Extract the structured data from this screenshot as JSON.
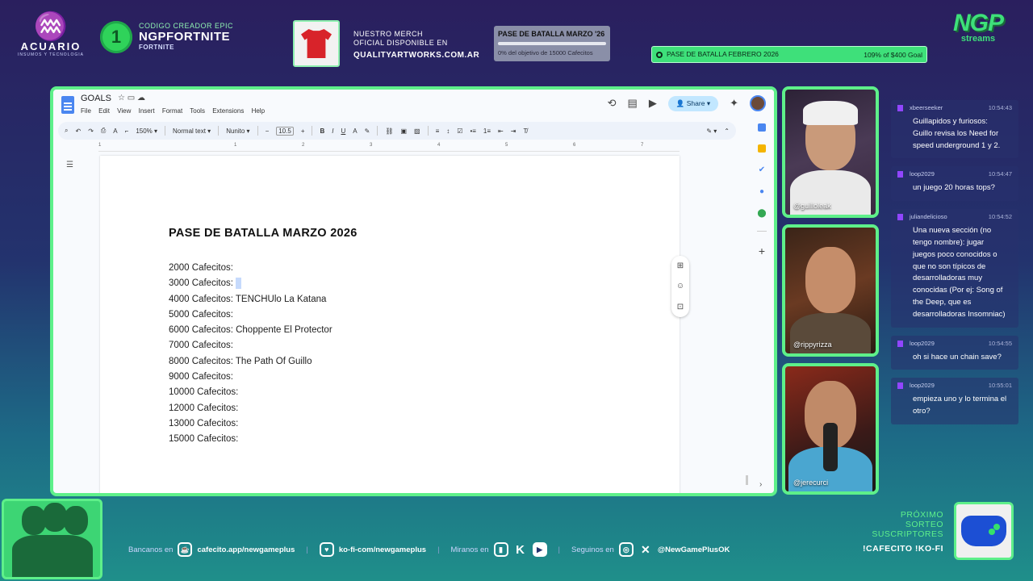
{
  "overlay": {
    "acuario": {
      "name": "ACUARIO",
      "sub": "INSUMOS Y TECNOLOGIA"
    },
    "creator_code": {
      "line1": "CODIGO CREADOR EPIC",
      "line2": "NGPFORTNITE",
      "line3": "FORTNITE",
      "badge": "1"
    },
    "merch": {
      "line1": "NUESTRO MERCH",
      "line2": "OFICIAL DISPONIBLE EN",
      "url": "QUALITYARTWORKS.COM.AR"
    },
    "goal_march": {
      "title": "PASE DE BATALLA MARZO '26",
      "progress": 0,
      "subtitle": "0% del objetivo de 15000 Cafecitos"
    },
    "goal_feb": {
      "title": "PASE DE BATALLA FEBRERO 2026",
      "value": "109% of $400 Goal"
    },
    "brand": {
      "big": "NGP",
      "small": "streams"
    }
  },
  "docs": {
    "title": "GOALS",
    "menu": [
      "File",
      "Edit",
      "View",
      "Insert",
      "Format",
      "Tools",
      "Extensions",
      "Help"
    ],
    "share_label": "Share",
    "toolbar": {
      "zoom": "150%",
      "style": "Normal text",
      "font": "Nunito",
      "font_size": "10.5"
    },
    "ruler": [
      "1",
      "1",
      "2",
      "3",
      "4",
      "5",
      "6",
      "7"
    ],
    "heading": "PASE DE BATALLA MARZO 2026",
    "lines": [
      "2000 Cafecitos:",
      "3000 Cafecitos:",
      "4000 Cafecitos: TENCHUlo La Katana",
      "5000 Cafecitos:",
      "6000 Cafecitos: Choppente El Protector",
      "7000 Cafecitos:",
      "8000 Cafecitos: The Path Of Guillo",
      "9000 Cafecitos:",
      "10000 Cafecitos:",
      "12000 Cafecitos:",
      "13000 Cafecitos:",
      "15000 Cafecitos:"
    ]
  },
  "cams": [
    {
      "handle": "@guilloleak"
    },
    {
      "handle": "@rippyrizza"
    },
    {
      "handle": "@jerecurci"
    }
  ],
  "chat": [
    {
      "user": "xbeerseeker",
      "time": "10:54:43",
      "text": "Guillapidos y furiosos: Guillo revisa los Need for speed underground 1 y 2."
    },
    {
      "user": "loop2029",
      "time": "10:54:47",
      "text": "un juego 20 horas tops?"
    },
    {
      "user": "juliandelicioso",
      "time": "10:54:52",
      "text": "Una nueva sección (no tengo nombre): jugar juegos poco conocidos o que no son típicos de desarrolladoras muy conocidas (Por ej: Song of the Deep, que es desarrolladoras Insomniac)"
    },
    {
      "user": "loop2029",
      "time": "10:54:55",
      "text": "oh si hace un chain save?"
    },
    {
      "user": "loop2029",
      "time": "10:55:01",
      "text": "empieza uno y lo termina el otro?"
    }
  ],
  "bottom": {
    "bancanos": "Bancanos en",
    "cafecito": "cafecito.app/newgameplus",
    "kofi": "ko-fi-com/newgameplus",
    "miranos": "Miranos en",
    "seguinos": "Seguinos en",
    "handle": "@NewGamePlusOK",
    "sorteo_lines": [
      "PRÓXIMO",
      "SORTEO",
      "SUSCRIPTORES"
    ],
    "sorteo_cmd": "!CAFECITO  !KO-FI"
  },
  "colors": {
    "accent": "#5ef08a",
    "share": "#c2e7ff",
    "twitch": "#9146ff"
  }
}
